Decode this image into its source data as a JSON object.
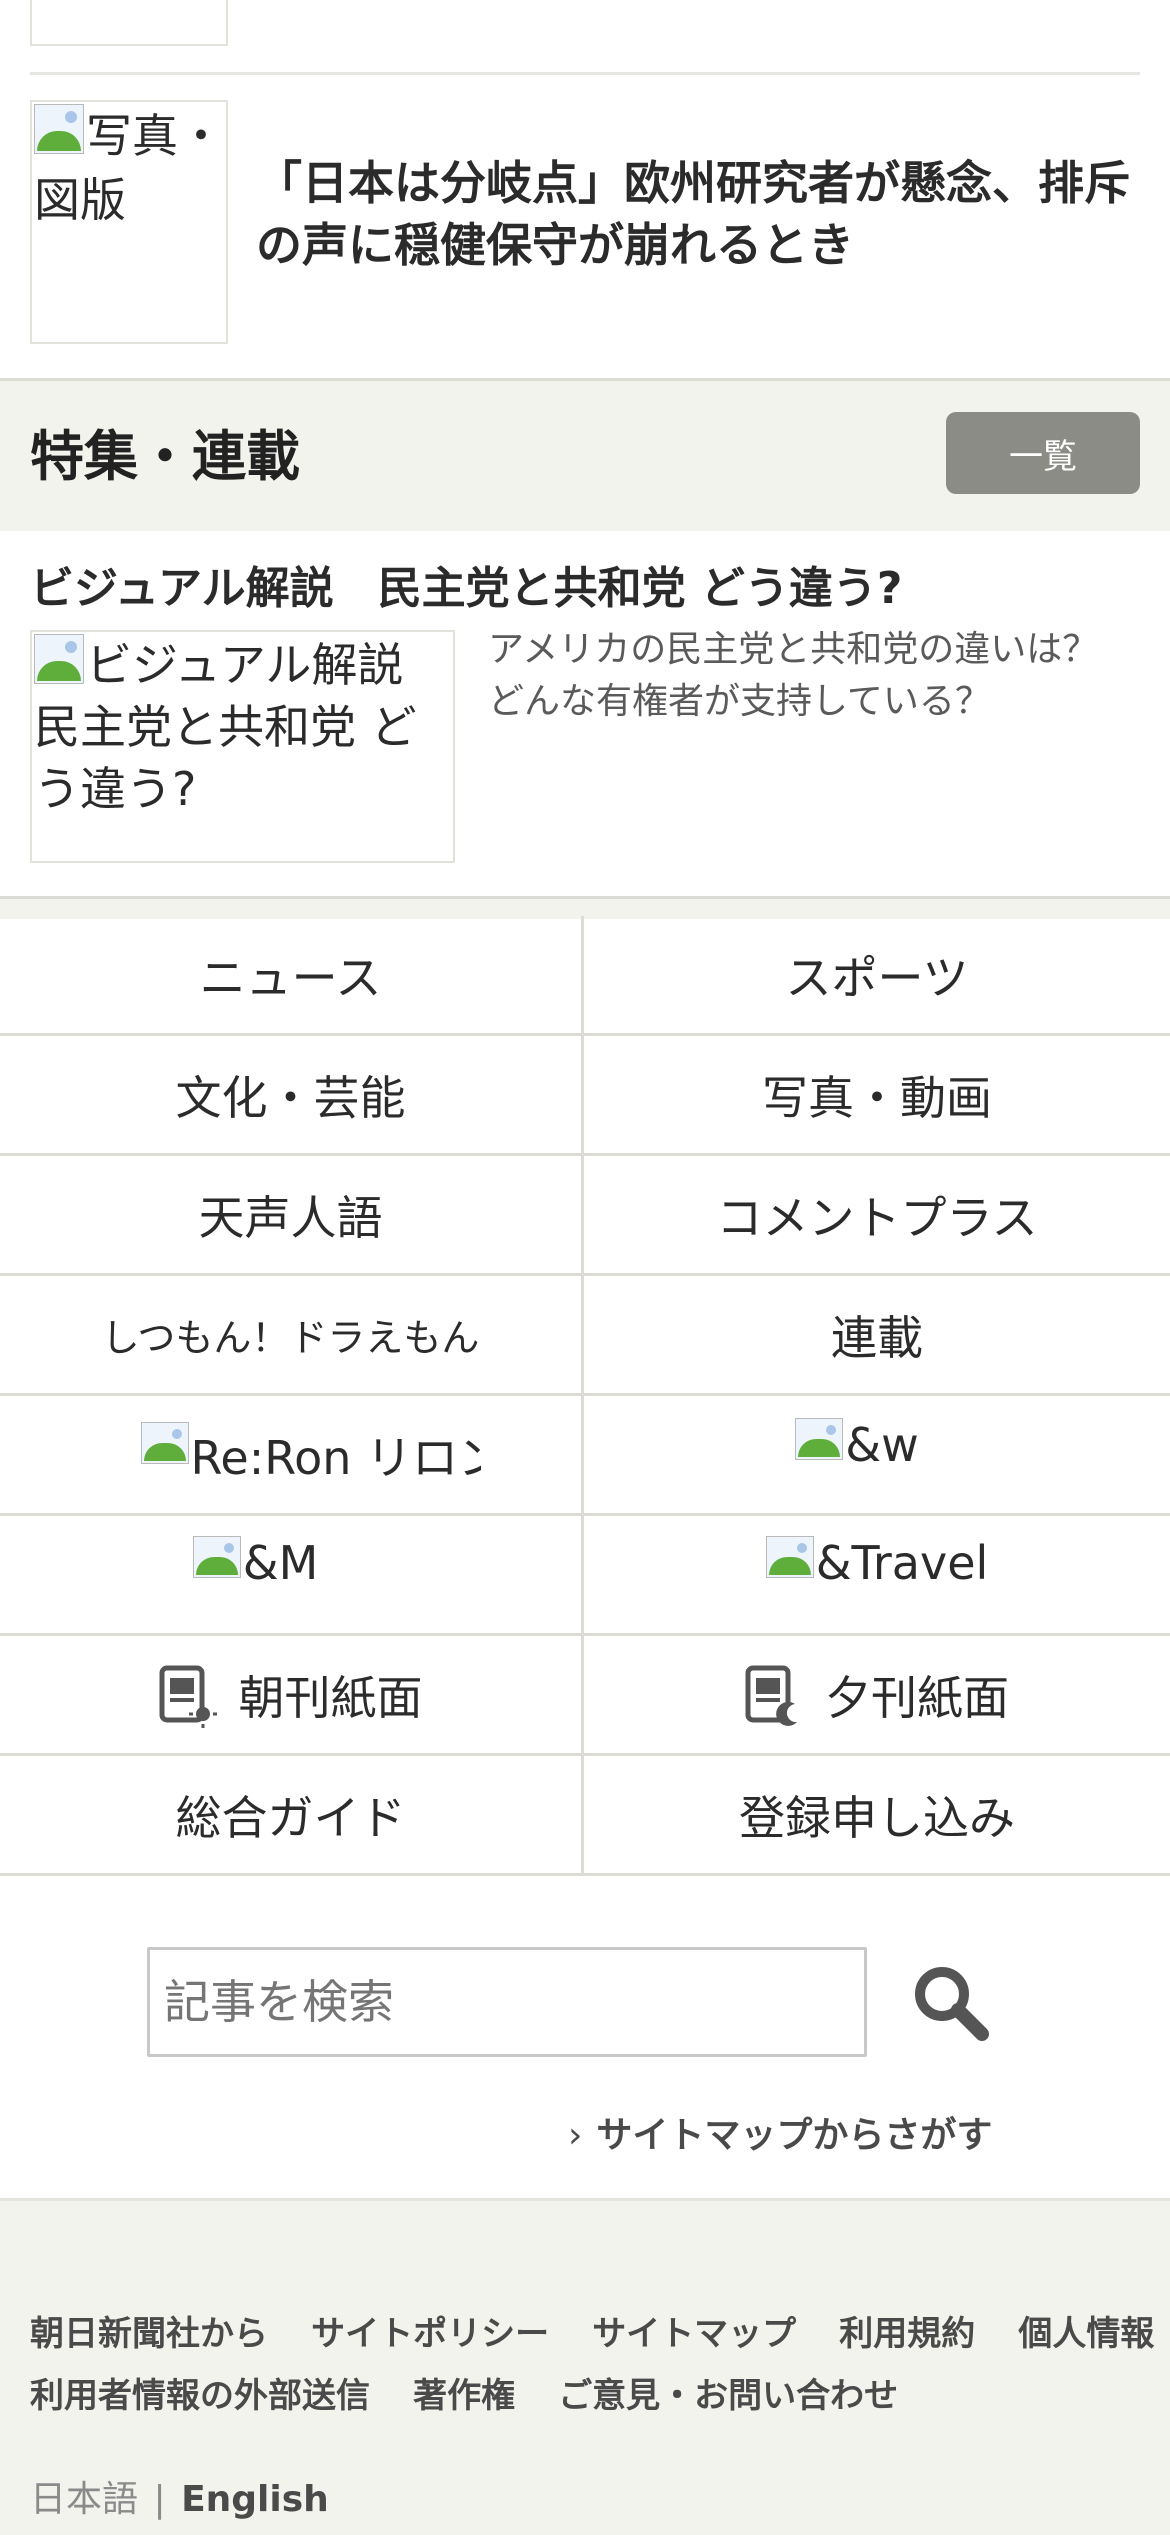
{
  "top_article": {
    "image_alt": "写真・図版",
    "title": "「日本は分岐点」欧州研究者が懸念、排斥の声に穏健保守が崩れるとき"
  },
  "feature_section": {
    "heading": "特集・連載",
    "list_button": "一覧",
    "feature_title": "ビジュアル解説　民主党と共和党 どう違う?",
    "feature_image_alt": "ビジュアル解説　民主党と共和党 どう違う?",
    "feature_desc": "アメリカの民主党と共和党の違いは？どんな有権者が支持している？"
  },
  "nav_grid": {
    "news": "ニュース",
    "sports": "スポーツ",
    "culture": "文化・芸能",
    "photo_video": "写真・動画",
    "tensei_jingo": "天声人語",
    "comment_plus": "コメントプラス",
    "doraemon": "しつもん！ドラえもん",
    "serial": "連載",
    "reron": "Re:Ron リロン",
    "and_w": "&w",
    "and_m": "&M",
    "and_travel": "&Travel",
    "morning_paper": "朝刊紙面",
    "evening_paper": "夕刊紙面",
    "guide": "総合ガイド",
    "register": "登録申し込み"
  },
  "search": {
    "placeholder": "記事を検索",
    "sitemap_link": "サイトマップからさがす"
  },
  "footer": {
    "links_row1": [
      "朝日新聞社から",
      "サイトポリシー",
      "サイトマップ",
      "利用規約",
      "個人情報"
    ],
    "links_row2": [
      "利用者情報の外部送信",
      "著作権",
      "ご意見・お問い合わせ"
    ],
    "lang_ja": "日本語",
    "lang_sep": "|",
    "lang_en": "English"
  },
  "colors": {
    "section_bg": "#f3f3ee",
    "button_gray": "#8c8c86",
    "divider": "#dcdcd4"
  }
}
